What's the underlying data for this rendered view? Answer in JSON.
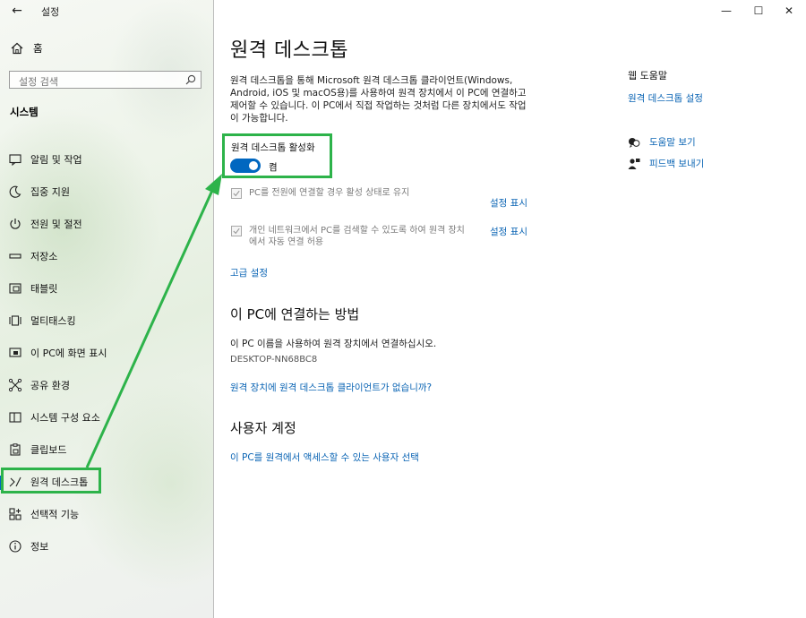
{
  "window": {
    "app_title": "설정",
    "back_glyph": "←",
    "minimize_glyph": "—",
    "maximize_glyph": "☐",
    "close_glyph": "✕"
  },
  "sidebar": {
    "home_label": "홈",
    "search_placeholder": "설정 검색",
    "section_title": "시스템",
    "items": [
      {
        "label": "알림 및 작업",
        "icon": "notification-icon"
      },
      {
        "label": "집중 지원",
        "icon": "moon-icon"
      },
      {
        "label": "전원 및 절전",
        "icon": "power-icon"
      },
      {
        "label": "저장소",
        "icon": "storage-icon"
      },
      {
        "label": "태블릿",
        "icon": "tablet-icon"
      },
      {
        "label": "멀티태스킹",
        "icon": "multitasking-icon"
      },
      {
        "label": "이 PC에 화면 표시",
        "icon": "projecting-icon"
      },
      {
        "label": "공유 환경",
        "icon": "shared-experiences-icon"
      },
      {
        "label": "시스템 구성 요소",
        "icon": "system-components-icon"
      },
      {
        "label": "클립보드",
        "icon": "clipboard-icon"
      },
      {
        "label": "원격 데스크톱",
        "icon": "remote-desktop-icon",
        "active": true
      },
      {
        "label": "선택적 기능",
        "icon": "optional-features-icon"
      },
      {
        "label": "정보",
        "icon": "info-icon"
      }
    ]
  },
  "main": {
    "title": "원격 데스크톱",
    "description": "원격 데스크톱을 통해 Microsoft 원격 데스크톱 클라이언트(Windows, Android, iOS 및 macOS용)를 사용하여 원격 장치에서 이 PC에 연결하고 제어할 수 있습니다. 이 PC에서 직접 작업하는 것처럼 다른 장치에서도 작업이 가능합니다.",
    "toggle_label": "원격 데스크톱 활성화",
    "toggle_state": "켬",
    "toggle_on": true,
    "option1_text": "PC를 전원에 연결할 경우 활성 상태로 유지",
    "option1_link": "설정 표시",
    "option2_text": "개인 네트워크에서 PC를 검색할 수 있도록 하여 원격 장치에서 자동 연결 허용",
    "option2_link": "설정 표시",
    "advanced_link": "고급 설정",
    "connect_heading": "이 PC에 연결하는 방법",
    "connect_text": "이 PC 이름을 사용하여 원격 장치에서 연결하십시오.",
    "pc_name": "DESKTOP-NN68BC8",
    "no_client_link": "원격 장치에 원격 데스크톱 클라이언트가 없습니까?",
    "accounts_heading": "사용자 계정",
    "select_users_link": "이 PC를 원격에서 액세스할 수 있는 사용자 선택"
  },
  "help": {
    "heading": "웹 도움말",
    "setup_link": "원격 데스크톱 설정",
    "get_help": "도움말 보기",
    "feedback": "피드백 보내기"
  },
  "colors": {
    "accent": "#0067c0",
    "link": "#0a64b4",
    "highlight_green": "#2db34a"
  }
}
